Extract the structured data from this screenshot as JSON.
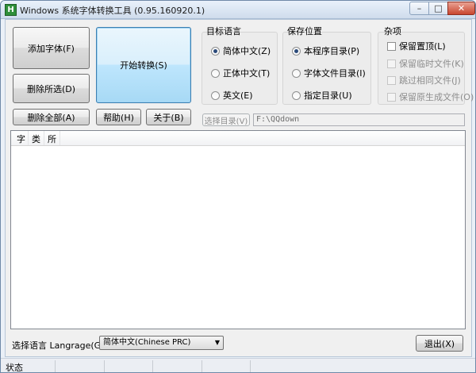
{
  "window": {
    "title": "Windows 系统字体转换工具 (0.95.160920.1)",
    "icon": "H",
    "min_icon": "minimize-icon",
    "max_icon": "maximize-icon",
    "close_icon": "close-icon"
  },
  "buttons": {
    "add_font": "添加字体(F)",
    "start_convert": "开始转换(S)",
    "remove_selected": "删除所选(D)",
    "remove_all": "删除全部(A)",
    "help": "帮助(H)",
    "about": "关于(B)",
    "choose_dir": "选择目录(V)",
    "exit": "退出(X)"
  },
  "target_language": {
    "title": "目标语言",
    "options": [
      "简体中文(Z)",
      "正体中文(T)",
      "英文(E)"
    ],
    "selected": 0
  },
  "save_location": {
    "title": "保存位置",
    "options": [
      "本程序目录(P)",
      "字体文件目录(I)",
      "指定目录(U)"
    ],
    "selected": 0
  },
  "misc": {
    "title": "杂项",
    "options": [
      {
        "label": "保留置顶(L)",
        "checked": false,
        "enabled": true
      },
      {
        "label": "保留临时文件(K)",
        "checked": false,
        "enabled": false
      },
      {
        "label": "跳过相同文件(J)",
        "checked": false,
        "enabled": false
      },
      {
        "label": "保留原生成文件(O)",
        "checked": false,
        "enabled": false
      }
    ]
  },
  "path": {
    "value": "F:\\QQdown"
  },
  "list": {
    "columns": [
      "字",
      "类",
      "所"
    ],
    "rows": []
  },
  "language_select": {
    "label": "选择语言 Langrage(G):",
    "value": "简体中文(Chinese PRC)"
  },
  "status": {
    "text": "状态"
  }
}
